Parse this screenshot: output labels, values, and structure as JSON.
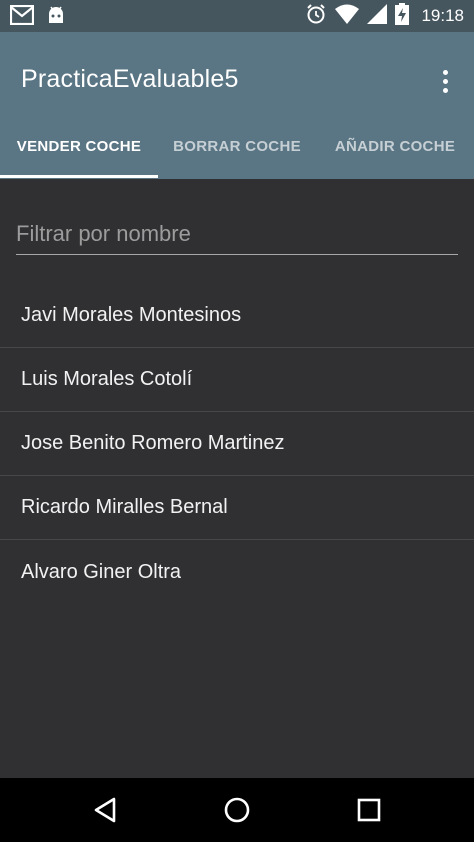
{
  "status_bar": {
    "time": "19:18",
    "icons": [
      "gmail-icon",
      "android-icon",
      "alarm-icon",
      "wifi-icon",
      "signal-icon",
      "battery-charging-icon"
    ]
  },
  "app_bar": {
    "title": "PracticaEvaluable5",
    "overflow_icon": "more-vert-icon"
  },
  "tabs": [
    {
      "label": "VENDER COCHE",
      "active": true
    },
    {
      "label": "BORRAR COCHE",
      "active": false
    },
    {
      "label": "AÑADIR COCHE",
      "active": false
    }
  ],
  "filter": {
    "placeholder": "Filtrar por nombre",
    "value": ""
  },
  "list": {
    "items": [
      "Javi Morales Montesinos",
      "Luis Morales Cotolí",
      "Jose Benito Romero Martinez",
      "Ricardo Miralles Bernal",
      "Alvaro Giner Oltra"
    ]
  },
  "nav_bar": {
    "icons": [
      "back-icon",
      "home-icon",
      "recents-icon"
    ]
  },
  "colors": {
    "status_bar": "#46565f",
    "app_bar": "#5a7584",
    "background": "#303033",
    "nav_bar": "#000000"
  }
}
